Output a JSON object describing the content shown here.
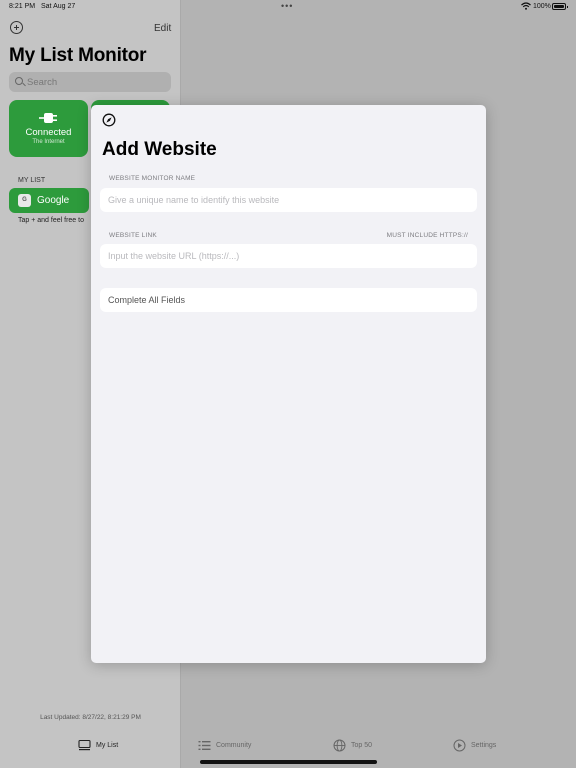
{
  "status_bar": {
    "time": "8:21 PM",
    "date": "Sat Aug 27",
    "battery": "100%"
  },
  "sidebar": {
    "edit_label": "Edit",
    "title": "My List Monitor",
    "search_placeholder": "Search",
    "cards": [
      {
        "title": "Connected",
        "subtitle": "The Internet"
      }
    ],
    "my_list_header": "MY LIST",
    "items": [
      {
        "badge": "G",
        "label": "Google"
      }
    ],
    "hint": "Tap + and feel free to",
    "last_updated": "Last Updated: 8/27/22, 8:21:29 PM"
  },
  "tabs": [
    {
      "label": "My List"
    },
    {
      "label": "Community"
    },
    {
      "label": "Top 50"
    },
    {
      "label": "Settings"
    }
  ],
  "modal": {
    "title": "Add Website",
    "name_label": "WEBSITE MONITOR NAME",
    "name_placeholder": "Give a unique name to identify this website",
    "link_label": "WEBSITE LINK",
    "link_note": "MUST INCLUDE HTTPS://",
    "link_placeholder": "Input the website URL (https://...)",
    "submit_label": "Complete All Fields"
  },
  "colors": {
    "green": "#2d9b3c",
    "modal_background": "#f2f2f6"
  },
  "icons": [
    "add-circle-icon",
    "search-icon",
    "plug-icon",
    "compass-icon",
    "list-icon",
    "globe-icon",
    "play-icon",
    "wifi-icon",
    "battery-icon"
  ]
}
